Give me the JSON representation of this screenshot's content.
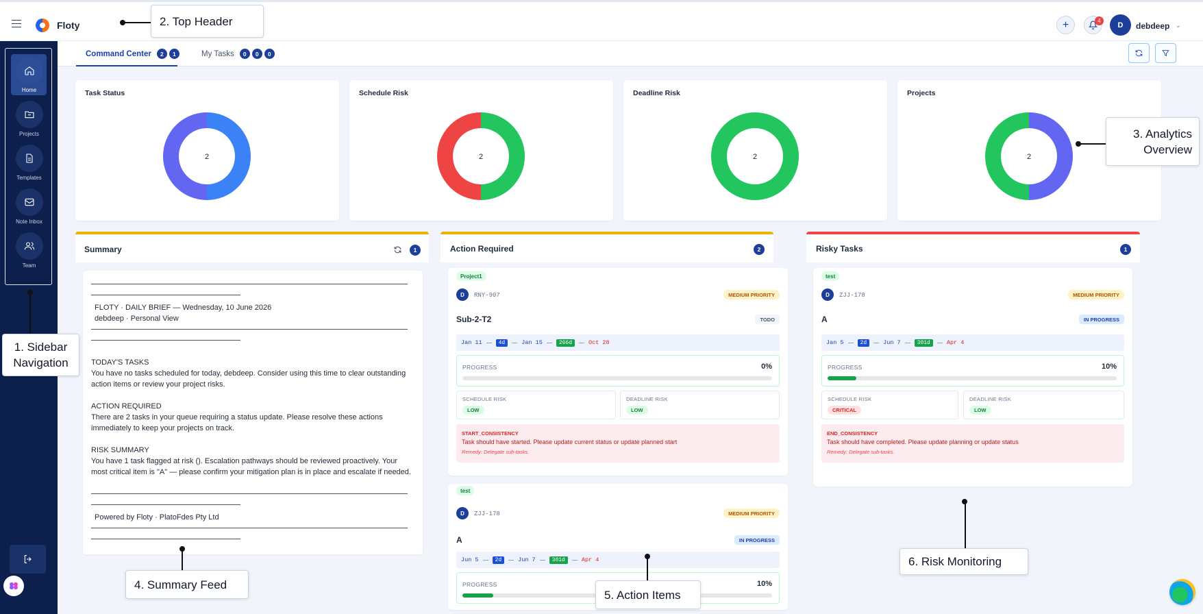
{
  "header": {
    "brand": "Floty",
    "notif_count": "4",
    "user_initial": "D",
    "user_name": "debdeep"
  },
  "sidebar": {
    "items": [
      {
        "label": "Home",
        "icon": "home-icon",
        "active": true
      },
      {
        "label": "Projects",
        "icon": "folder-icon"
      },
      {
        "label": "Templates",
        "icon": "document-icon"
      },
      {
        "label": "Note Inbox",
        "icon": "inbox-icon"
      },
      {
        "label": "Team",
        "icon": "team-icon"
      }
    ]
  },
  "tabs": [
    {
      "label": "Command Center",
      "counts": [
        "2",
        "1"
      ],
      "active": true
    },
    {
      "label": "My Tasks",
      "counts": [
        "0",
        "0",
        "0"
      ]
    }
  ],
  "analytics": [
    {
      "title": "Task Status",
      "center": "2"
    },
    {
      "title": "Schedule Risk",
      "center": "2"
    },
    {
      "title": "Deadline Risk",
      "center": "2"
    },
    {
      "title": "Projects",
      "center": "2"
    }
  ],
  "chart_data": [
    {
      "type": "pie",
      "title": "Task Status",
      "labels": [
        "",
        ""
      ],
      "values": [
        1,
        1
      ],
      "colors": [
        "#3b82f6",
        "#6366f1"
      ],
      "total": 2
    },
    {
      "type": "pie",
      "title": "Schedule Risk",
      "labels": [
        "",
        ""
      ],
      "values": [
        1,
        1
      ],
      "colors": [
        "#22c55e",
        "#ef4444"
      ],
      "total": 2
    },
    {
      "type": "pie",
      "title": "Deadline Risk",
      "labels": [
        ""
      ],
      "values": [
        2
      ],
      "colors": [
        "#22c55e"
      ],
      "total": 2
    },
    {
      "type": "pie",
      "title": "Projects",
      "labels": [
        "",
        ""
      ],
      "values": [
        1,
        1
      ],
      "colors": [
        "#6366f1",
        "#22c55e"
      ],
      "total": 2
    }
  ],
  "summary": {
    "title": "Summary",
    "count": "1",
    "brief_line1": "FLOTY · DAILY BRIEF — Wednesday, 10 June 2026",
    "brief_line2": "debdeep · Personal View",
    "today_head": "TODAY'S TASKS",
    "today_l1": "You have no tasks scheduled for today, debdeep. Consider using this time to clear outstanding",
    "today_l2": "action items or review your project risks.",
    "action_head": "ACTION REQUIRED",
    "action_l1": "There are 2 tasks in your queue requiring a status update. Please resolve these actions",
    "action_l2": "immediately to keep your projects on track.",
    "risk_head": "RISK SUMMARY",
    "risk_l1": "You have 1 task flagged at risk (). Escalation pathways should be reviewed proactively. Your",
    "risk_l2": "most critical item is \"A\" — please confirm your mitigation plan is in place and escalate if needed.",
    "footer": "Powered by Floty · PlatoFdes Pty Ltd"
  },
  "action_required": {
    "title": "Action Required",
    "count": "2",
    "cards": [
      {
        "project": "Project1",
        "initial": "D",
        "id": "RNY-907",
        "priority": "MEDIUM PRIORITY",
        "name": "Sub-2-T2",
        "status": "TODO",
        "start": "Jan 11",
        "d1": "4d",
        "mid": "Jan 15",
        "d2": "266d",
        "end": "Oct 28",
        "progress_label": "PROGRESS",
        "progress_text": "0%",
        "progress": 0,
        "sched_label": "SCHEDULE RISK",
        "sched": "LOW",
        "dead_label": "DEADLINE RISK",
        "dead": "LOW",
        "alert_key": "START_CONSISTENCY",
        "alert_msg": "Task should have started. Please update current status or update planned start",
        "remedy": "Remedy: Delegate sub-tasks."
      },
      {
        "project": "test",
        "initial": "D",
        "id": "ZJJ-178",
        "priority": "MEDIUM PRIORITY",
        "name": "A",
        "status": "IN PROGRESS",
        "start": "Jun 5",
        "d1": "2d",
        "mid": "Jun 7",
        "d2": "301d",
        "end": "Apr 4",
        "progress_label": "PROGRESS",
        "progress_text": "10%",
        "progress": 10
      }
    ]
  },
  "risky": {
    "title": "Risky Tasks",
    "count": "1",
    "card": {
      "project": "test",
      "initial": "D",
      "id": "ZJJ-178",
      "priority": "MEDIUM PRIORITY",
      "name": "A",
      "status": "IN PROGRESS",
      "start": "Jan 5",
      "d1": "2d",
      "mid": "Jun 7",
      "d2": "301d",
      "end": "Apr 4",
      "progress_label": "PROGRESS",
      "progress_text": "10%",
      "progress": 10,
      "sched_label": "SCHEDULE RISK",
      "sched": "CRITICAL",
      "dead_label": "DEADLINE RISK",
      "dead": "LOW",
      "alert_key": "END_CONSISTENCY",
      "alert_msg": "Task should have completed. Please update planning or update status",
      "remedy": "Remedy: Delegate sub-tasks."
    }
  },
  "callouts": {
    "c1a": "1. Sidebar",
    "c1b": "Navigation",
    "c2": "2. Top Header",
    "c3a": "3. Analytics",
    "c3b": "Overview",
    "c4": "4. Summary Feed",
    "c5": "5. Action Items",
    "c6": "6. Risk Monitoring"
  }
}
